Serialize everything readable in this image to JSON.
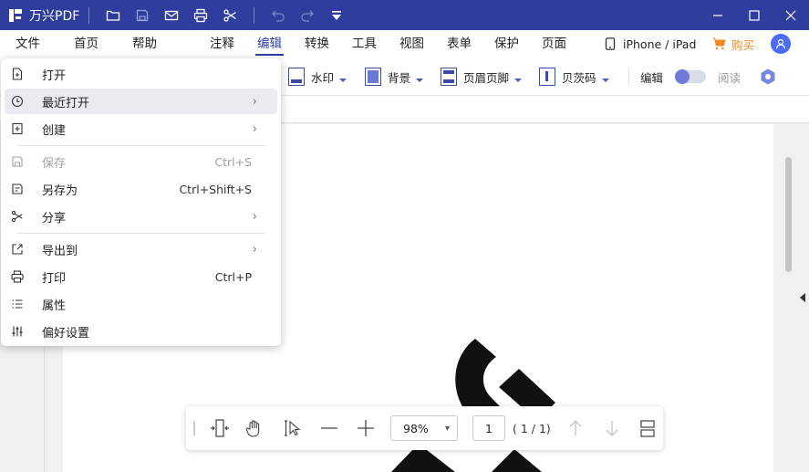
{
  "app": {
    "title": "万兴PDF"
  },
  "menubar": {
    "items": [
      {
        "label": "文件"
      },
      {
        "label": "首页"
      },
      {
        "label": "帮助"
      },
      {
        "label": "注释"
      },
      {
        "label": "编辑",
        "active": true
      },
      {
        "label": "转换"
      },
      {
        "label": "工具"
      },
      {
        "label": "视图"
      },
      {
        "label": "表单"
      },
      {
        "label": "保护"
      },
      {
        "label": "页面"
      }
    ],
    "device_label": "iPhone / iPad",
    "buy_label": "购买"
  },
  "ribbon": {
    "watermark": "水印",
    "background": "背景",
    "header_footer": "页眉页脚",
    "bates": "贝茨码",
    "edit_mode": "编辑",
    "read_mode": "阅读"
  },
  "file_menu": {
    "items": [
      {
        "label": "打开",
        "icon": "open-file-icon"
      },
      {
        "label": "最近打开",
        "icon": "clock-icon",
        "submenu": true,
        "hover": true
      },
      {
        "label": "创建",
        "icon": "create-file-icon",
        "submenu": true
      },
      {
        "label": "保存",
        "icon": "save-icon",
        "shortcut": "Ctrl+S",
        "disabled": true
      },
      {
        "label": "另存为",
        "icon": "save-as-icon",
        "shortcut": "Ctrl+Shift+S"
      },
      {
        "label": "分享",
        "icon": "share-icon",
        "submenu": true
      },
      {
        "label": "导出到",
        "icon": "export-icon",
        "submenu": true
      },
      {
        "label": "打印",
        "icon": "print-icon",
        "shortcut": "Ctrl+P"
      },
      {
        "label": "属性",
        "icon": "list-icon"
      },
      {
        "label": "偏好设置",
        "icon": "sliders-icon"
      }
    ],
    "arrow": "›"
  },
  "bottom_toolbar": {
    "zoom": "98%",
    "page_value": "1",
    "page_count": "( 1 / 1)"
  },
  "colors": {
    "titlebar": "#2f3e9e",
    "accent": "#2f3e9e",
    "buy": "#f08a24"
  }
}
